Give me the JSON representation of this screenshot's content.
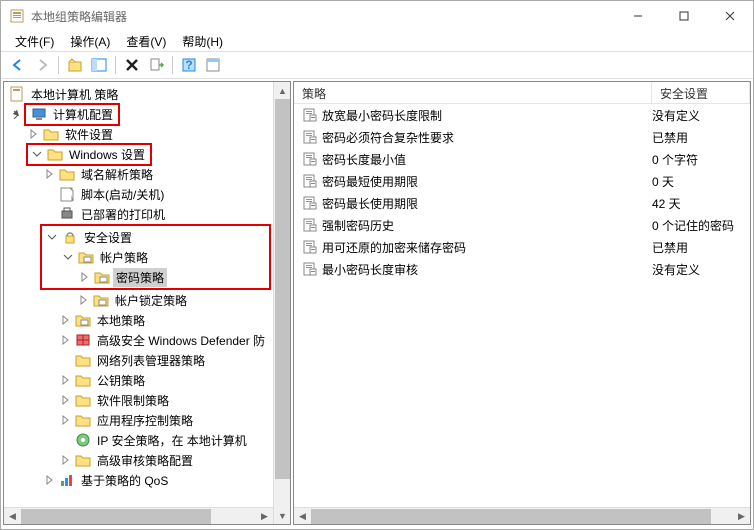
{
  "title": "本地组策略编辑器",
  "menus": {
    "file": "文件(F)",
    "action": "操作(A)",
    "view": "查看(V)",
    "help": "帮助(H)"
  },
  "tree": {
    "root": "本地计算机 策略",
    "computer_config": "计算机配置",
    "software_settings": "软件设置",
    "windows_settings": "Windows 设置",
    "dns_policy": "域名解析策略",
    "scripts": "脚本(启动/关机)",
    "deployed_printers": "已部署的打印机",
    "security_settings": "安全设置",
    "account_policies": "帐户策略",
    "password_policy": "密码策略",
    "account_lockout": "帐户锁定策略",
    "local_policies": "本地策略",
    "defender": "高级安全 Windows Defender 防",
    "network_list": "网络列表管理器策略",
    "public_key": "公钥策略",
    "software_restriction": "软件限制策略",
    "app_control": "应用程序控制策略",
    "ip_security": "IP 安全策略，在 本地计算机",
    "advanced_audit": "高级审核策略配置",
    "policy_qos": "基于策略的 QoS"
  },
  "columns": {
    "policy": "策略",
    "setting": "安全设置"
  },
  "policies": [
    {
      "name": "放宽最小密码长度限制",
      "setting": "没有定义"
    },
    {
      "name": "密码必须符合复杂性要求",
      "setting": "已禁用"
    },
    {
      "name": "密码长度最小值",
      "setting": "0 个字符"
    },
    {
      "name": "密码最短使用期限",
      "setting": "0 天"
    },
    {
      "name": "密码最长使用期限",
      "setting": "42 天"
    },
    {
      "name": "强制密码历史",
      "setting": "0 个记住的密码"
    },
    {
      "name": "用可还原的加密来储存密码",
      "setting": "已禁用"
    },
    {
      "name": "最小密码长度审核",
      "setting": "没有定义"
    }
  ]
}
